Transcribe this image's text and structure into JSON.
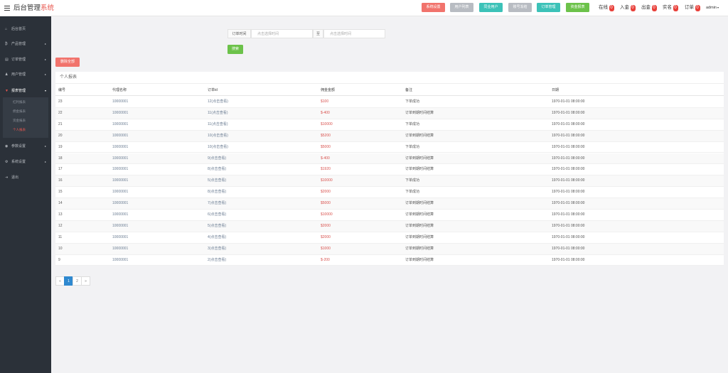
{
  "header": {
    "brand_main": "后台管理",
    "brand_accent": "系统",
    "buttons": [
      {
        "label": "系统设置",
        "color": "#f1736c"
      },
      {
        "label": "用户列表",
        "color": "#b8bcc2"
      },
      {
        "label": "同业用户",
        "color": "#3cc2b8"
      },
      {
        "label": "账号冻结",
        "color": "#b8bcc2"
      },
      {
        "label": "订单管理",
        "color": "#3cc2b8"
      },
      {
        "label": "资金报表",
        "color": "#6cc24a"
      }
    ],
    "stats": [
      {
        "label": "在线",
        "count": "0"
      },
      {
        "label": "入金",
        "count": "0"
      },
      {
        "label": "出金",
        "count": "0"
      },
      {
        "label": "实名",
        "count": "0"
      },
      {
        "label": "订单",
        "count": "0"
      }
    ],
    "user": "admin"
  },
  "sidebar": {
    "items": [
      {
        "icon": "home-icon",
        "glyph": "⌂",
        "label": "后台首页"
      },
      {
        "icon": "product-icon",
        "glyph": "₿",
        "label": "产品管理"
      },
      {
        "icon": "order-icon",
        "glyph": "▤",
        "label": "订单管理"
      },
      {
        "icon": "user-icon",
        "glyph": "♟",
        "label": "用户管理"
      },
      {
        "icon": "report-icon",
        "glyph": "▼",
        "label": "报表管理"
      },
      {
        "icon": "param-icon",
        "glyph": "◉",
        "label": "参数设置"
      },
      {
        "icon": "system-icon",
        "glyph": "⚙",
        "label": "系统设置"
      },
      {
        "icon": "exit-icon",
        "glyph": "⇥",
        "label": "退出"
      }
    ],
    "subitems": [
      "红利报表",
      "佣金报表",
      "资金报表",
      "个人报表"
    ]
  },
  "filter": {
    "label": "订单时间",
    "start_placeholder": "点击选择时间",
    "separator": "至",
    "end_placeholder": "点击选择时间",
    "search_label": "搜索"
  },
  "delete_all_label": "删除全部",
  "panel": {
    "title": "个人报表",
    "columns": [
      "编号",
      "代理名称",
      "订单id",
      "佣金金额",
      "备注",
      "日期"
    ],
    "rows": [
      [
        "23",
        "10000001",
        "12(点击查看)",
        "$100",
        "下单成功",
        "1970-01-01 08:00:00"
      ],
      [
        "22",
        "10000001",
        "11(点击查看)",
        "$-400",
        "订单到期时间结算",
        "1970-01-01 08:00:00"
      ],
      [
        "21",
        "10000001",
        "11(点击查看)",
        "$10000",
        "下单成功",
        "1970-01-01 08:00:00"
      ],
      [
        "20",
        "10000001",
        "10(点击查看)",
        "$5200",
        "订单到期时间结算",
        "1970-01-01 08:00:00"
      ],
      [
        "19",
        "10000001",
        "10(点击查看)",
        "$5000",
        "下单成功",
        "1970-01-01 08:00:00"
      ],
      [
        "18",
        "10000001",
        "9(点击查看)",
        "$-400",
        "订单到期时间结算",
        "1970-01-01 08:00:00"
      ],
      [
        "17",
        "10000001",
        "8(点击查看)",
        "$1920",
        "订单到期时间结算",
        "1970-01-01 08:00:00"
      ],
      [
        "16",
        "10000001",
        "5(点击查看)",
        "$10000",
        "下单成功",
        "1970-01-01 08:00:00"
      ],
      [
        "15",
        "10000001",
        "8(点击查看)",
        "$2000",
        "下单成功",
        "1970-01-01 08:00:00"
      ],
      [
        "14",
        "10000001",
        "7(点击查看)",
        "$5000",
        "订单到期时间结算",
        "1970-01-01 08:00:00"
      ],
      [
        "13",
        "10000001",
        "6(点击查看)",
        "$10000",
        "订单到期时间结算",
        "1970-01-01 08:00:00"
      ],
      [
        "12",
        "10000001",
        "5(点击查看)",
        "$2000",
        "订单到期时间结算",
        "1970-01-01 08:00:00"
      ],
      [
        "11",
        "10000001",
        "4(点击查看)",
        "$2000",
        "订单到期时间结算",
        "1970-01-01 08:00:00"
      ],
      [
        "10",
        "10000001",
        "3(点击查看)",
        "$1000",
        "订单到期时间结算",
        "1970-01-01 08:00:00"
      ],
      [
        "9",
        "10000001",
        "2(点击查看)",
        "$-200",
        "订单到期时间结算",
        "1970-01-01 08:00:00"
      ]
    ]
  },
  "pagination": {
    "prev": "«",
    "pages": [
      "1",
      "2"
    ],
    "next": "»",
    "current": "1"
  }
}
